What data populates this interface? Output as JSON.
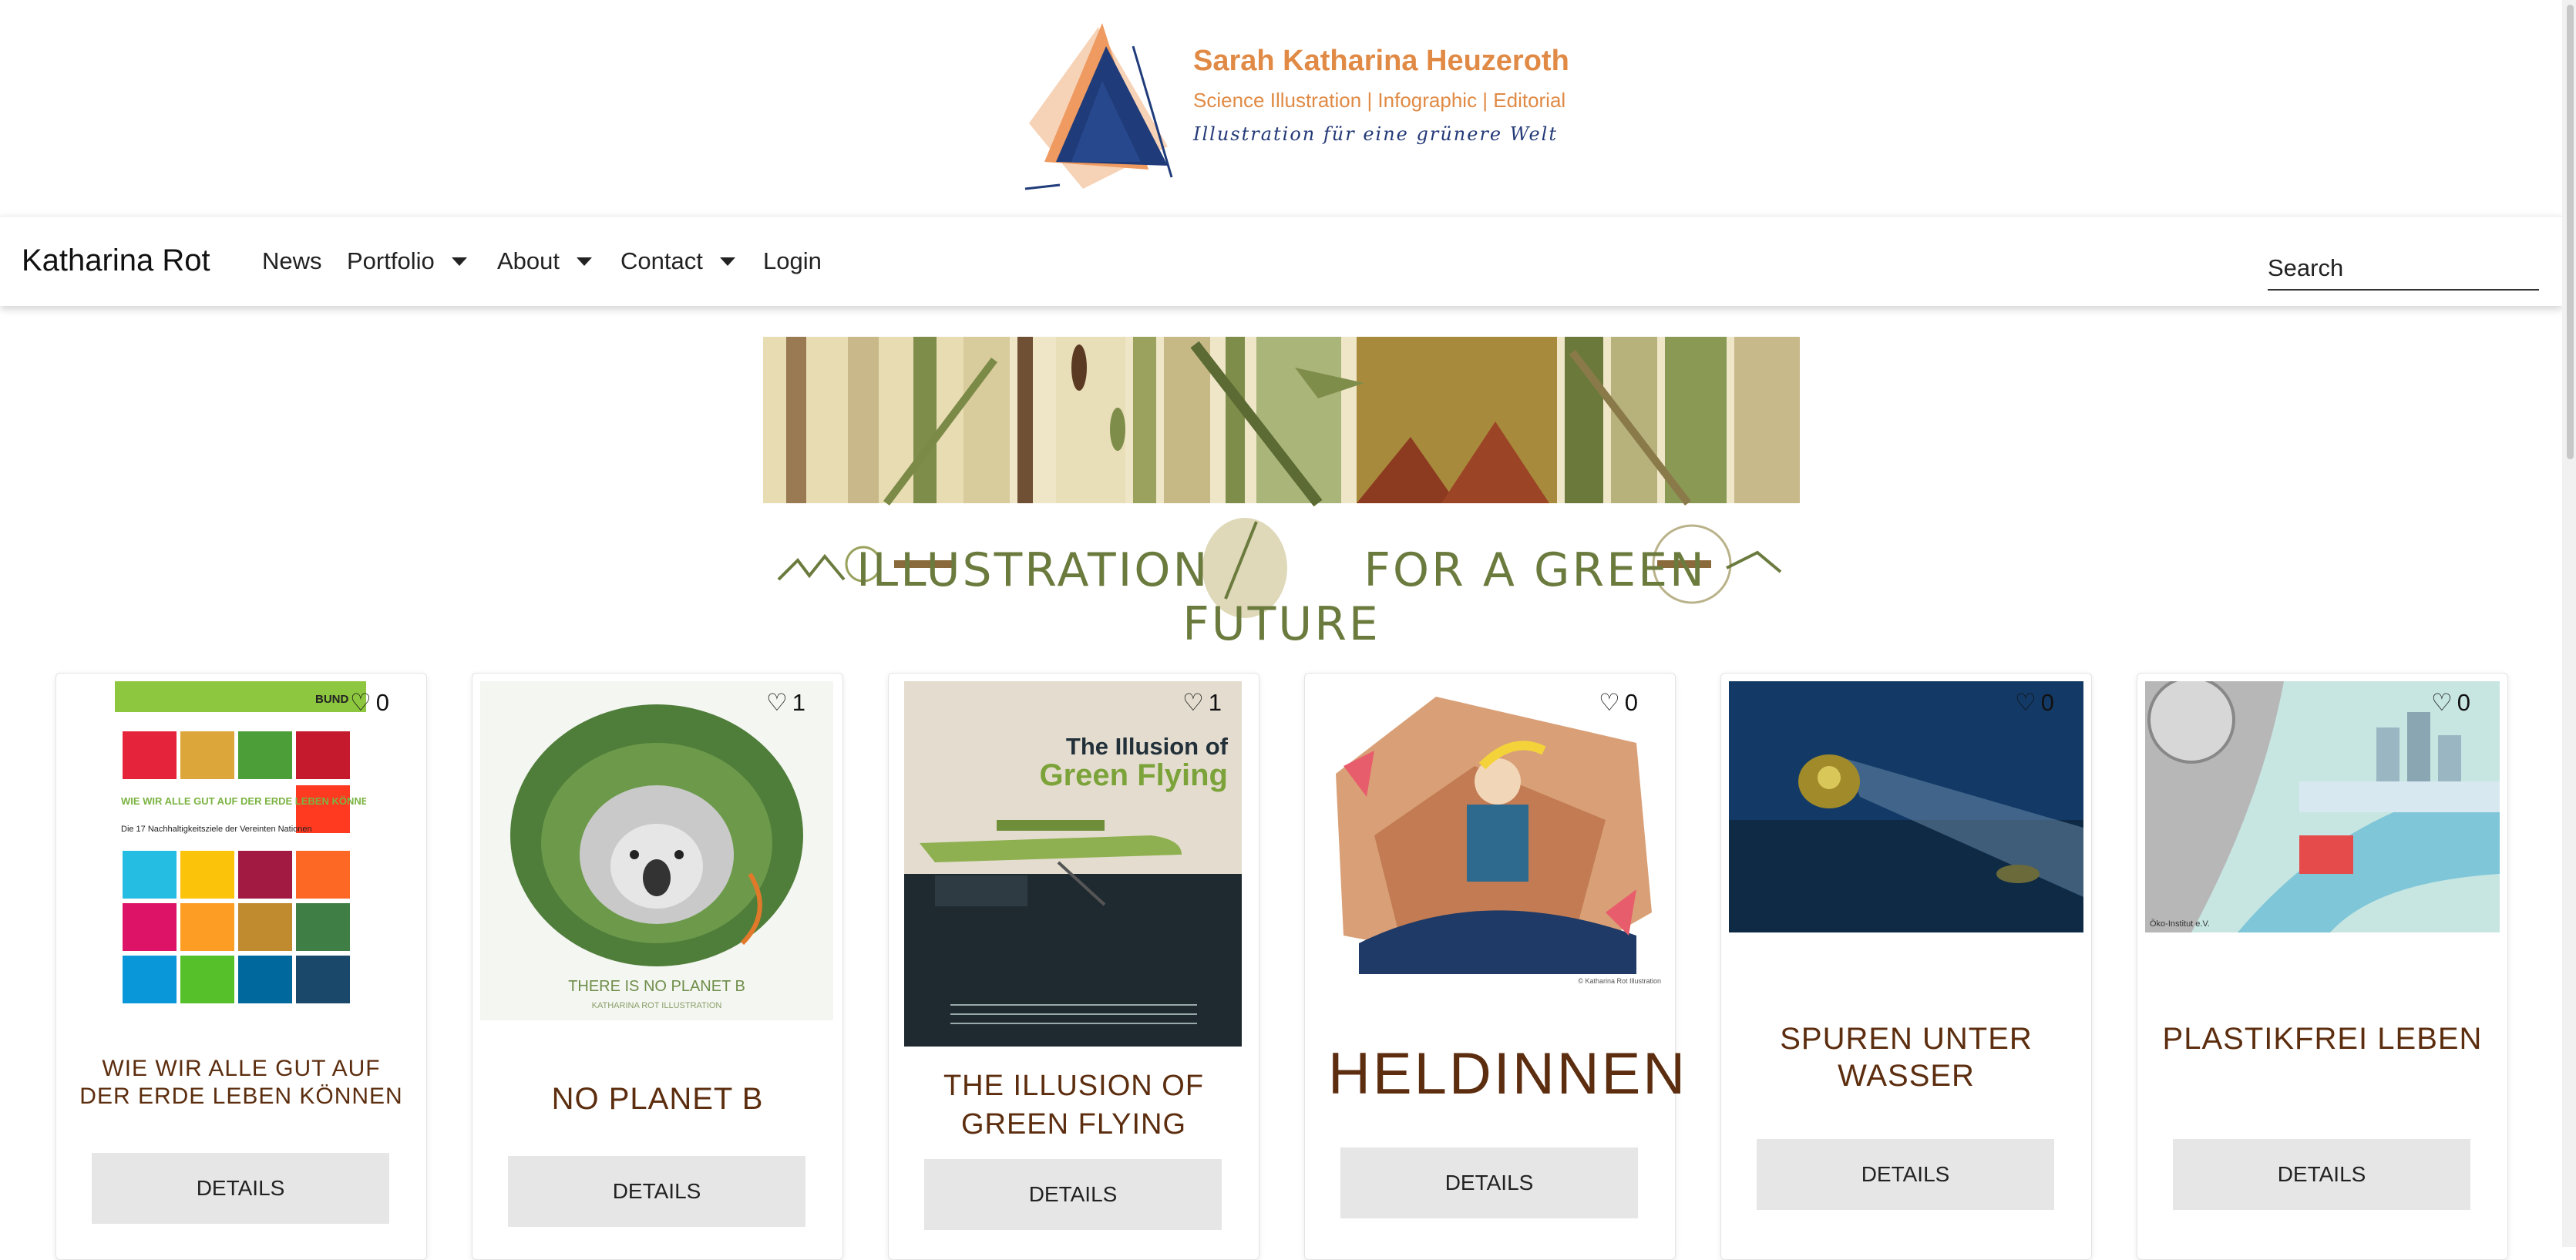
{
  "logo": {
    "name": "Sarah Katharina Heuzeroth",
    "subtitle": "Science Illustration | Infographic |  Editorial",
    "tagline": "Illustration für eine grünere Welt"
  },
  "nav": {
    "brand": "Katharina Rot",
    "items": [
      {
        "label": "News",
        "dropdown": false
      },
      {
        "label": "Portfolio",
        "dropdown": true
      },
      {
        "label": "About",
        "dropdown": true
      },
      {
        "label": "Contact",
        "dropdown": true
      },
      {
        "label": "Login",
        "dropdown": false
      }
    ],
    "search_placeholder": "Search"
  },
  "banner": {
    "left_text": "ILLUSTRATION",
    "right_text": "FOR A GREEN FUTURE"
  },
  "cards": [
    {
      "title": "WIE WIR ALLE GUT AUF DER ERDE LEBEN KÖNNEN",
      "likes": "0",
      "button": "DETAILS"
    },
    {
      "title": "NO PLANET B",
      "likes": "1",
      "button": "DETAILS"
    },
    {
      "title": "THE ILLUSION OF GREEN FLYING",
      "likes": "1",
      "button": "DETAILS"
    },
    {
      "title": "HELDINNEN",
      "likes": "0",
      "button": "DETAILS"
    },
    {
      "title": "SPUREN UNTER WASSER",
      "likes": "0",
      "button": "DETAILS"
    },
    {
      "title": "PLASTIKFREI LEBEN",
      "likes": "0",
      "button": "DETAILS"
    }
  ],
  "artwork_text": {
    "sdg_title": "WIE WIR ALLE GUT AUF DER ERDE LEBEN KÖNNEN",
    "sdg_subtitle": "Die 17 Nachhaltigkeitsziele der Vereinten Nationen",
    "sdg_badge": "BUND",
    "planet_caption": "THERE IS NO PLANET B",
    "planet_credit": "KATHARINA ROT ILLUSTRATION",
    "flying_title_1": "The Illusion of",
    "flying_title_2": "Green Flying",
    "heldinnen_credit": "© Katharina Rot Illustration",
    "plastik_badge": "Öko-Institut e.V."
  },
  "colors": {
    "logo_orange": "#e08a45",
    "logo_navy": "#243a78",
    "card_title_brown": "#5c2d0e",
    "banner_green": "#6b7b3e",
    "button_gray": "#e6e6e6"
  }
}
